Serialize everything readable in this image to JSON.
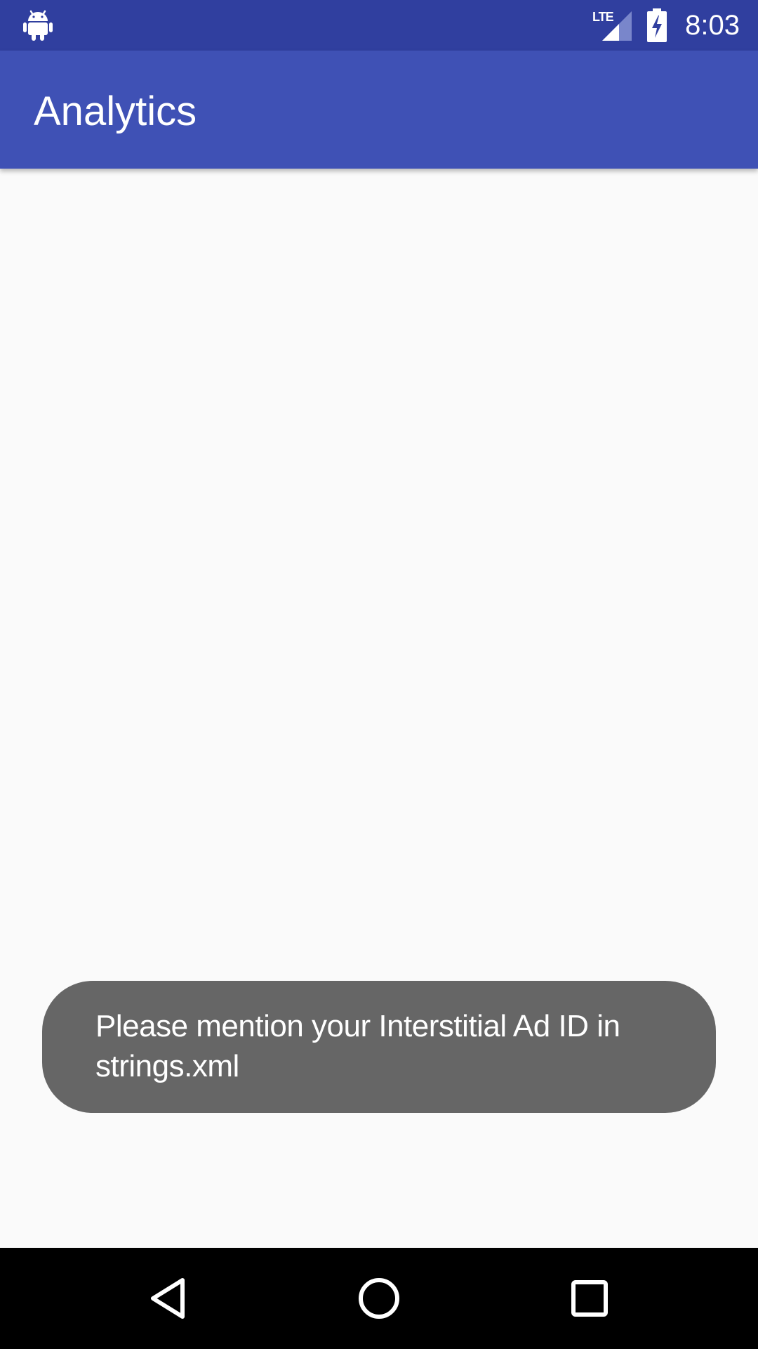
{
  "status_bar": {
    "network_label": "LTE",
    "clock": "8:03"
  },
  "app_bar": {
    "title": "Analytics"
  },
  "toast": {
    "message": "Please mention your Interstitial Ad ID in strings.xml"
  },
  "nav_bar": {
    "back_icon": "back-triangle-icon",
    "home_icon": "home-circle-icon",
    "recents_icon": "recents-square-icon"
  },
  "colors": {
    "status_bar": "#303f9f",
    "app_bar": "#3f51b5",
    "background": "#fafafa",
    "toast": "#666666",
    "nav_bar": "#000000"
  }
}
